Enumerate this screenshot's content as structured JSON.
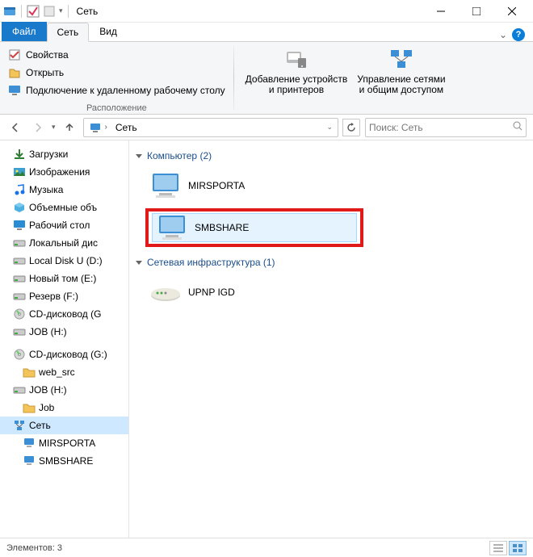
{
  "window": {
    "title": "Сеть"
  },
  "tabs": {
    "file": "Файл",
    "network": "Сеть",
    "view": "Вид"
  },
  "ribbon": {
    "properties": "Свойства",
    "open": "Открыть",
    "remoteDesktop": "Подключение к удаленному рабочему столу",
    "groupLocation": "Расположение",
    "addDevices": "Добавление устройств\nи принтеров",
    "manageNetwork": "Управление сетями\nи общим доступом"
  },
  "breadcrumb": {
    "path": "Сеть",
    "refreshChevron": "⟳"
  },
  "search": {
    "placeholder": "Поиск: Сеть"
  },
  "sidebar": {
    "items": [
      {
        "label": "Загрузки",
        "icon": "downloads"
      },
      {
        "label": "Изображения",
        "icon": "pictures"
      },
      {
        "label": "Музыка",
        "icon": "music"
      },
      {
        "label": "Объемные объ",
        "icon": "3d"
      },
      {
        "label": "Рабочий стол",
        "icon": "desktop"
      },
      {
        "label": "Локальный дис",
        "icon": "drive"
      },
      {
        "label": "Local Disk U (D:)",
        "icon": "drive"
      },
      {
        "label": "Новый том (E:)",
        "icon": "drive"
      },
      {
        "label": "Резерв (F:)",
        "icon": "drive"
      },
      {
        "label": "CD-дисковод (G",
        "icon": "cd"
      },
      {
        "label": "JOB (H:)",
        "icon": "drive"
      }
    ],
    "ext": [
      {
        "label": "CD-дисковод (G:)",
        "icon": "cd"
      },
      {
        "label": "web_src",
        "icon": "folder",
        "level": 2
      },
      {
        "label": "JOB (H:)",
        "icon": "drive"
      },
      {
        "label": "Job",
        "icon": "folder",
        "level": 2
      },
      {
        "label": "Сеть",
        "icon": "network",
        "selected": true
      },
      {
        "label": "MIRSPORTA",
        "icon": "computer",
        "level": 2
      },
      {
        "label": "SMBSHARE",
        "icon": "computer",
        "level": 2
      }
    ]
  },
  "content": {
    "groupComputer": "Компьютер (2)",
    "groupInfra": "Сетевая инфраструктура (1)",
    "computers": [
      {
        "name": "MIRSPORTA",
        "highlighted": false
      },
      {
        "name": "SMBSHARE",
        "highlighted": true
      }
    ],
    "infra": [
      {
        "name": "UPNP IGD"
      }
    ]
  },
  "status": {
    "text": "Элементов: 3"
  }
}
